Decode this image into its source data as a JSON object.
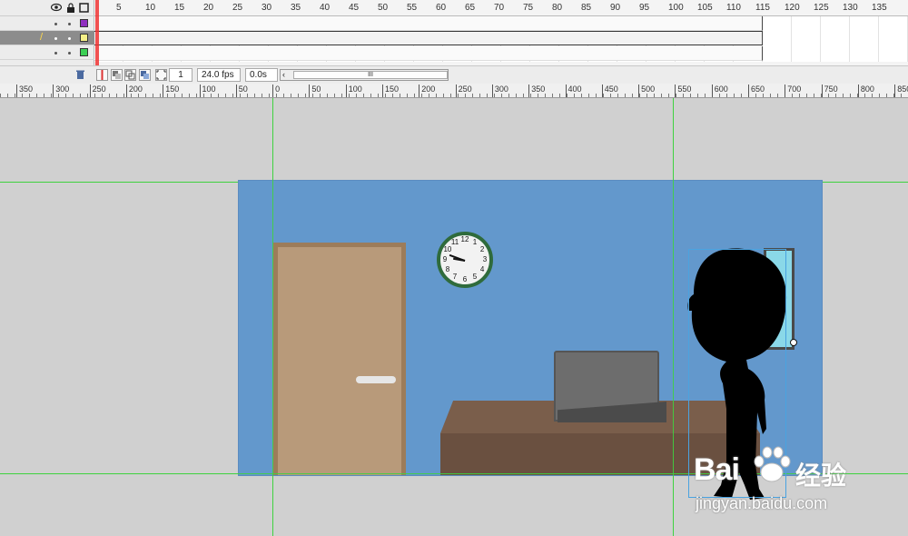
{
  "timeline": {
    "layers": [
      {
        "swatch_color": "#8f2fbf"
      },
      {
        "swatch_color": "#f6f088",
        "selected": true
      },
      {
        "swatch_color": "#3ccf55"
      }
    ],
    "frame_numbers": [
      "5",
      "10",
      "15",
      "20",
      "25",
      "30",
      "35",
      "40",
      "45",
      "50",
      "55",
      "60",
      "65",
      "70",
      "75",
      "80",
      "85",
      "90",
      "95",
      "100",
      "105",
      "110",
      "115",
      "120",
      "125",
      "130",
      "135"
    ],
    "footer": {
      "current_frame": "1",
      "fps": "24.0 fps",
      "elapsed": "0.0s",
      "scroll_thumb": "III"
    }
  },
  "ruler": {
    "labels": [
      "350",
      "300",
      "250",
      "200",
      "150",
      "100",
      "50",
      "0",
      "50",
      "100",
      "150",
      "200",
      "250",
      "300",
      "350",
      "400",
      "450",
      "500",
      "550",
      "600",
      "650",
      "700",
      "750",
      "800",
      "850"
    ]
  },
  "clock": {
    "numbers": [
      "12",
      "1",
      "2",
      "3",
      "4",
      "5",
      "6",
      "7",
      "8",
      "9",
      "10",
      "11"
    ]
  },
  "watermark": {
    "brand": "Bai",
    "brand_suffix": "经验",
    "url": "jingyan.baidu.com"
  },
  "colors": {
    "stage": "#6398cc",
    "guide": "#3fd13f",
    "workarea": "#d0d0d0"
  }
}
